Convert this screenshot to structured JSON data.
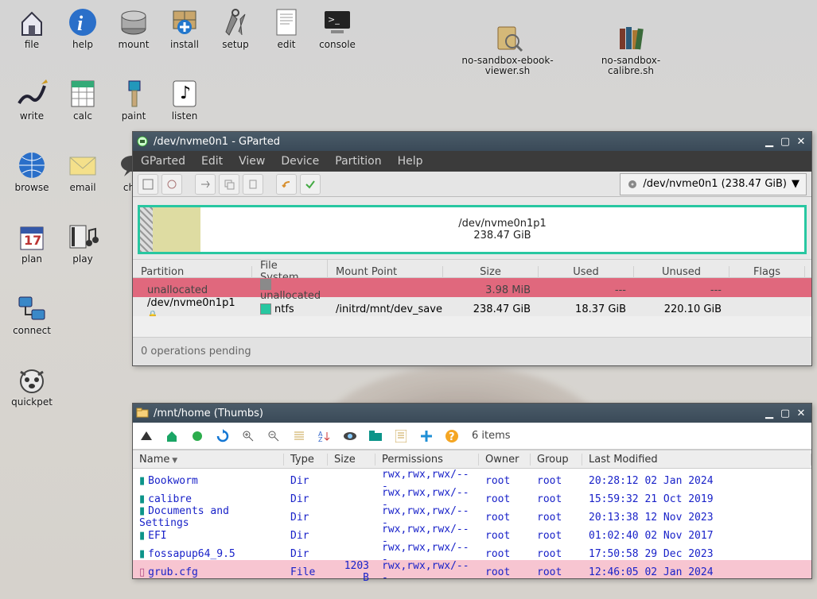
{
  "desktop_icons": {
    "r0": [
      "file",
      "help",
      "mount",
      "install",
      "setup",
      "edit",
      "console"
    ],
    "r1": [
      "write",
      "calc",
      "paint",
      "listen"
    ],
    "r2": [
      "browse",
      "email",
      "chat"
    ],
    "r3": [
      "plan",
      "play"
    ],
    "r4": [
      "connect"
    ],
    "r5": [
      "quickpet"
    ],
    "extra": [
      "no-sandbox-ebook-viewer.sh",
      "no-sandbox-calibre.sh"
    ]
  },
  "gparted": {
    "title": "/dev/nvme0n1 - GParted",
    "menus": [
      "GParted",
      "Edit",
      "View",
      "Device",
      "Partition",
      "Help"
    ],
    "device_selector": "/dev/nvme0n1 (238.47 GiB)",
    "graph": {
      "name": "/dev/nvme0n1p1",
      "size": "238.47 GiB"
    },
    "columns": [
      "Partition",
      "File System",
      "Mount Point",
      "Size",
      "Used",
      "Unused",
      "Flags"
    ],
    "rows": [
      {
        "partition": "unallocated",
        "fs": "unallocated",
        "fs_color": "#8a8a8a",
        "mount": "",
        "size": "3.98 MiB",
        "used": "---",
        "unused": "---",
        "flags": "",
        "class": "unalloc",
        "lock": false
      },
      {
        "partition": "/dev/nvme0n1p1",
        "fs": "ntfs",
        "fs_color": "#28c7a1",
        "mount": "/initrd/mnt/dev_save",
        "size": "238.47 GiB",
        "used": "18.37 GiB",
        "unused": "220.10 GiB",
        "flags": "",
        "class": "",
        "lock": true
      }
    ],
    "status": "0 operations pending"
  },
  "fm": {
    "title": "/mnt/home (Thumbs)",
    "count": "6 items",
    "columns": [
      "Name",
      "Type",
      "Size",
      "Permissions",
      "Owner",
      "Group",
      "Last Modified"
    ],
    "rows": [
      {
        "name": "Bookworm",
        "type": "Dir",
        "size": "",
        "perm": "rwx,rwx,rwx/---",
        "owner": "root",
        "group": "root",
        "mod": "20:28:12 02 Jan 2024",
        "icon": "folder"
      },
      {
        "name": "calibre",
        "type": "Dir",
        "size": "",
        "perm": "rwx,rwx,rwx/---",
        "owner": "root",
        "group": "root",
        "mod": "15:59:32 21 Oct 2019",
        "icon": "folder"
      },
      {
        "name": "Documents and Settings",
        "type": "Dir",
        "size": "",
        "perm": "rwx,rwx,rwx/---",
        "owner": "root",
        "group": "root",
        "mod": "20:13:38 12 Nov 2023",
        "icon": "folder"
      },
      {
        "name": "EFI",
        "type": "Dir",
        "size": "",
        "perm": "rwx,rwx,rwx/---",
        "owner": "root",
        "group": "root",
        "mod": "01:02:40 02 Nov 2017",
        "icon": "folder"
      },
      {
        "name": "fossapup64_9.5",
        "type": "Dir",
        "size": "",
        "perm": "rwx,rwx,rwx/---",
        "owner": "root",
        "group": "root",
        "mod": "17:50:58 29 Dec 2023",
        "icon": "folder"
      },
      {
        "name": "grub.cfg",
        "type": "File",
        "size": "1203 B",
        "perm": "rwx,rwx,rwx/---",
        "owner": "root",
        "group": "root",
        "mod": "12:46:05 02 Jan 2024",
        "icon": "file",
        "sel": true
      }
    ]
  }
}
